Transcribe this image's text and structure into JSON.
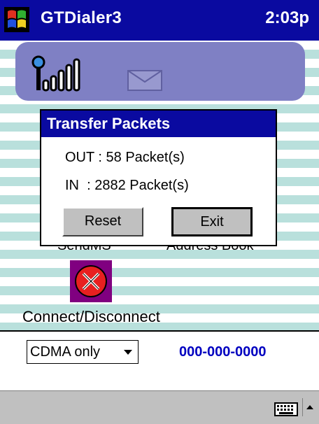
{
  "titlebar": {
    "title": "GTDialer3",
    "time": "2:03p",
    "start_icon": "windows-flag-icon"
  },
  "status": {
    "signal_icon": "signal-strength-icon",
    "mail_icon": "envelope-icon"
  },
  "background_labels": {
    "left": "SendMS",
    "right": "Address Book"
  },
  "dialog": {
    "title": "Transfer Packets",
    "out_text": "OUT : 58 Packet(s)",
    "in_text": "IN  : 2882 Packet(s)",
    "reset_label": "Reset",
    "exit_label": "Exit"
  },
  "connect": {
    "icon": "disconnect-x-icon",
    "label": "Connect/Disconnect"
  },
  "bottom": {
    "mode_value": "CDMA only",
    "phone_number": "000-000-0000"
  },
  "menubar": {
    "keyboard_icon": "keyboard-icon",
    "sip_arrow_icon": "chevron-up-icon"
  },
  "colors": {
    "titlebar": "#0a0aa0",
    "panel": "#7f80c4",
    "stripe": "#b9e0dc",
    "phone": "#0000c0",
    "tile": "#800080"
  }
}
